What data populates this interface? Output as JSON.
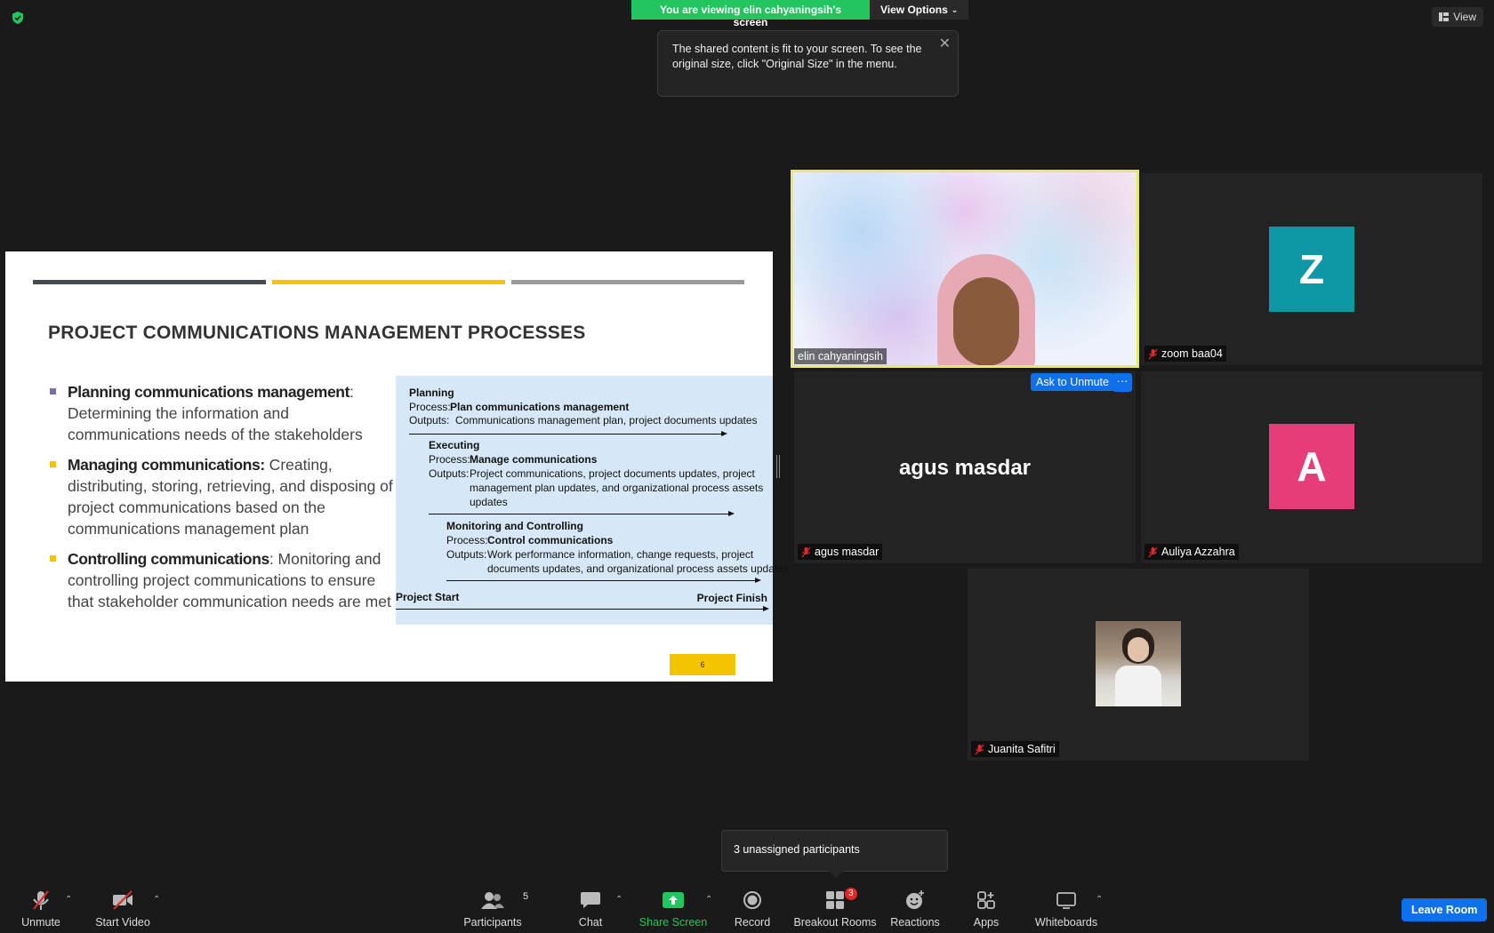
{
  "meeting": {
    "banner_text": "You are viewing elin cahyaningsih's screen",
    "view_options_label": "View Options",
    "view_label": "View",
    "toast_text": "The shared content is fit to your screen. To see the original size, click \"Original Size\" in the menu."
  },
  "slide": {
    "title": "PROJECT COMMUNICATIONS MANAGEMENT PROCESSES",
    "bar_colors": [
      "#454a4f",
      "#f5c400",
      "#9a9a9a"
    ],
    "bullets": [
      {
        "bold": "Planning communications management",
        "rest": ": Determining the information and communications needs of the stakeholders",
        "color": "#7a6aa8"
      },
      {
        "bold": "Managing communications:",
        "rest": " Creating, distributing, storing, retrieving, and disposing of project communications based on the communications management plan",
        "color": "#f5c400"
      },
      {
        "bold": "Controlling communications",
        "rest": ": Monitoring and controlling project communications to ensure that stakeholder communication needs are met",
        "color": "#f5c400"
      }
    ],
    "diagram": {
      "planning_label": "Planning",
      "planning_process_key": "Process:",
      "planning_process": "Plan communications management",
      "planning_outputs_key": "Outputs:",
      "planning_outputs": "Communications management plan, project documents updates",
      "executing_label": "Executing",
      "executing_process_key": "Process:",
      "executing_process": "Manage communications",
      "executing_outputs_key": "Outputs:",
      "executing_outputs_1": "Project communications, project documents updates, project",
      "executing_outputs_2": "management plan updates, and organizational process assets",
      "executing_outputs_3": "updates",
      "monitoring_label": "Monitoring and Controlling",
      "monitoring_process_key": "Process:",
      "monitoring_process": "Control communications",
      "monitoring_outputs_key": "Outputs:",
      "monitoring_outputs_1": "Work performance information, change requests, project",
      "monitoring_outputs_2": "documents updates, and organizational process assets updates",
      "project_start": "Project Start",
      "project_finish": "Project Finish"
    },
    "page_number": "6"
  },
  "participants": [
    {
      "name": "elin cahyaningsih",
      "active": true
    },
    {
      "name": "zoom baa04",
      "initial": "Z",
      "avatar_color": "#0e98a6"
    },
    {
      "name": "agus masdar",
      "big_name": "agus masdar"
    },
    {
      "name": "Auliya Azzahra",
      "initial": "A",
      "avatar_color": "#e63d7a"
    },
    {
      "name": "Juanita Safitri"
    }
  ],
  "ask_to_unmute_label": "Ask to Unmute",
  "more_label": "···",
  "breakout_popup": "3 unassigned participants",
  "toolbar": {
    "unmute": "Unmute",
    "start_video": "Start Video",
    "participants": "Participants",
    "participants_count": "5",
    "chat": "Chat",
    "share_screen": "Share Screen",
    "record": "Record",
    "breakout_rooms": "Breakout Rooms",
    "breakout_badge": "3",
    "reactions": "Reactions",
    "apps": "Apps",
    "whiteboards": "Whiteboards",
    "leave_room": "Leave Room"
  }
}
